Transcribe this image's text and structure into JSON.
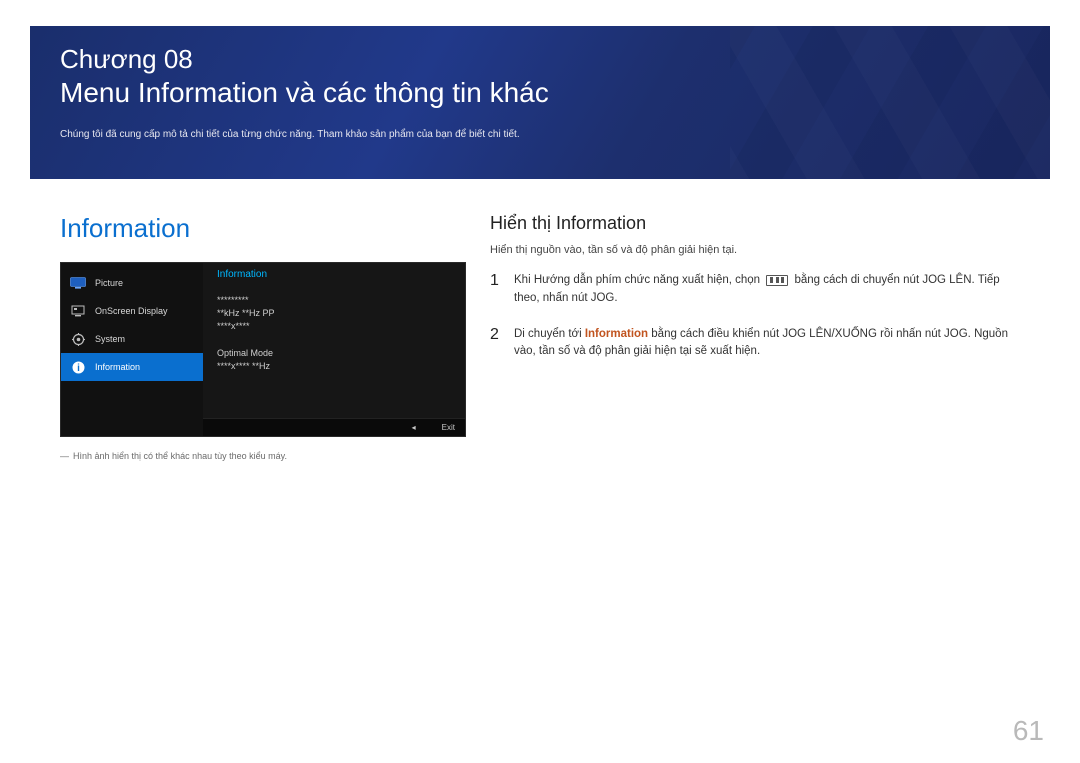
{
  "header": {
    "chapter_label": "Chương 08",
    "chapter_title": "Menu Information và các thông tin khác",
    "chapter_sub": "Chúng tôi đã cung cấp mô tả chi tiết của từng chức năng. Tham khảo sản phẩm của bạn để biết chi tiết."
  },
  "left": {
    "heading": "Information",
    "osd": {
      "title": "Information",
      "menu": [
        {
          "icon": "monitor",
          "label": "Picture",
          "selected": false
        },
        {
          "icon": "disp",
          "label": "OnScreen Display",
          "selected": false
        },
        {
          "icon": "gear",
          "label": "System",
          "selected": false
        },
        {
          "icon": "info",
          "label": "Information",
          "selected": true
        }
      ],
      "info_line1": "*********",
      "info_line2": "**kHz **Hz PP",
      "info_line3": "****x****",
      "info_line4": "Optimal Mode",
      "info_line5": "****x**** **Hz",
      "footer_arrow": "◂",
      "footer_exit": "Exit"
    },
    "note_dash": "―",
    "note": "Hình ảnh hiển thị có thể khác nhau tùy theo kiểu máy."
  },
  "right": {
    "heading": "Hiển thị Information",
    "subtext": "Hiển thị nguồn vào, tần số và độ phân giải hiện tại.",
    "steps": [
      {
        "num": "1",
        "pre": "Khi Hướng dẫn phím chức năng xuất hiện, chọn ",
        "post": " bằng cách di chuyển nút JOG LÊN. Tiếp theo, nhấn nút JOG."
      },
      {
        "num": "2",
        "pre": "Di chuyển tới ",
        "hl": "Information",
        "post": " bằng cách điều khiển nút JOG LÊN/XUỐNG rồi nhấn nút JOG. Nguồn vào, tần số và độ phân giải hiện tại sẽ xuất hiện."
      }
    ]
  },
  "page_number": "61"
}
